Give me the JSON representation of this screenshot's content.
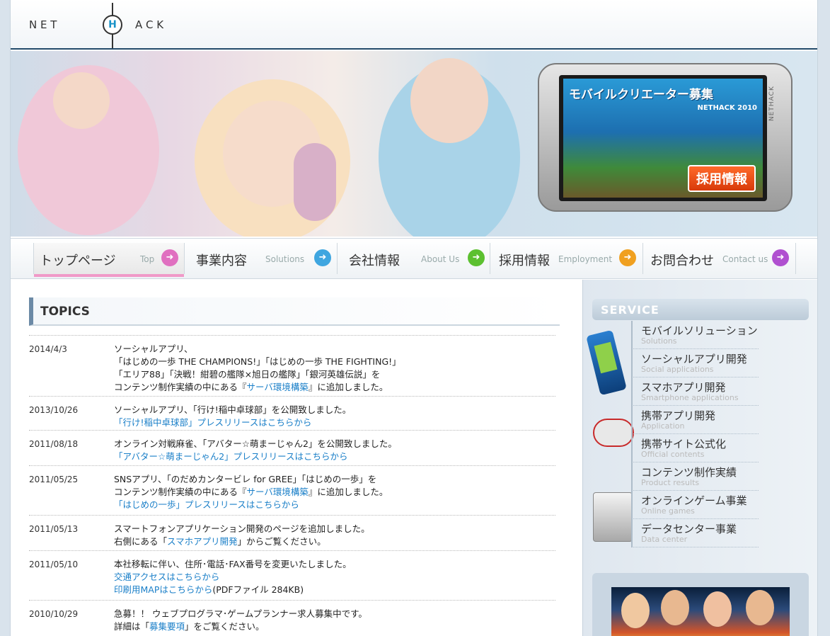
{
  "logo": {
    "left": "N E T",
    "h": "H",
    "right": "A C K"
  },
  "banner": {
    "title": "モバイルクリエーター募集",
    "subtitle": "NETHACK 2010",
    "button": "採用情報",
    "phone_brand": "NETHACK"
  },
  "nav": [
    {
      "ja": "トップページ",
      "en": "Top",
      "color": "#e070c0"
    },
    {
      "ja": "事業内容",
      "en": "Solutions",
      "color": "#3fa6e0"
    },
    {
      "ja": "会社情報",
      "en": "About Us",
      "color": "#5cc030"
    },
    {
      "ja": "採用情報",
      "en": "Employment",
      "color": "#f0a020"
    },
    {
      "ja": "お問合わせ",
      "en": "Contact us",
      "color": "#b050d0"
    }
  ],
  "topics": {
    "title": "TOPICS",
    "items": [
      {
        "date": "2014/4/3",
        "l1": "ソーシャルアプリ、",
        "l2": "「はじめの一歩 THE CHAMPIONS!」「はじめの一歩 THE FIGHTING!」",
        "l3": "「エリア88」「決戦！紺碧の艦隊×旭日の艦隊」「銀河英雄伝説」を",
        "l4a": "コンテンツ制作実績の中にある『",
        "l4link": "サーバ環境構築",
        "l4b": "』に追加しました。"
      },
      {
        "date": "2013/10/26",
        "l1": "ソーシャルアプリ、「行け!稲中卓球部」を公開致しました。",
        "link": "「行け!稲中卓球部」プレスリリースはこちらから"
      },
      {
        "date": "2011/08/18",
        "l1": "オンライン対戦麻雀、「アバター☆萌まーじゃん2」を公開致しました。",
        "link": "「アバター☆萌まーじゃん2」プレスリリースはこちらから"
      },
      {
        "date": "2011/05/25",
        "l1": "SNSアプリ、「のだめカンタービレ for GREE」「はじめの一歩」を",
        "l2a": "コンテンツ制作実績の中にある『",
        "l2link": "サーバ環境構築",
        "l2b": "』に追加しました。",
        "link": "「はじめの一歩」プレスリリースはこちらから"
      },
      {
        "date": "2011/05/13",
        "l1": "スマートフォンアプリケーション開発のページを追加しました。",
        "l2a": "右側にある「",
        "l2link": "スマホアプリ開発",
        "l2b": "」からご覧ください。"
      },
      {
        "date": "2011/05/10",
        "l1": "本社移転に伴い、住所･電話･FAX番号を変更いたしました。",
        "link1": "交通アクセスはこちらから",
        "link2": "印刷用MAPはこちらから",
        "link2suffix": "(PDFファイル 284KB)"
      },
      {
        "date": "2010/10/29",
        "l1": "急募！！ ウェブプログラマ･ゲームプランナー求人募集中です。",
        "l2a": "詳細は「",
        "l2link": "募集要項",
        "l2b": "」をご覧ください。"
      }
    ]
  },
  "service": {
    "title": "SERVICE",
    "items": [
      {
        "ja": "モバイルソリューション",
        "en": "Solutions"
      },
      {
        "ja": "ソーシャルアプリ開発",
        "en": "Social applications"
      },
      {
        "ja": "スマホアプリ開発",
        "en": "Smartphone applications"
      },
      {
        "ja": "携帯アプリ開発",
        "en": "Application"
      },
      {
        "ja": "携帯サイト公式化",
        "en": "Official contents"
      },
      {
        "ja": "コンテンツ制作実績",
        "en": "Product results"
      },
      {
        "ja": "オンラインゲーム事業",
        "en": "Online games"
      },
      {
        "ja": "データセンター事業",
        "en": "Data center"
      }
    ]
  }
}
